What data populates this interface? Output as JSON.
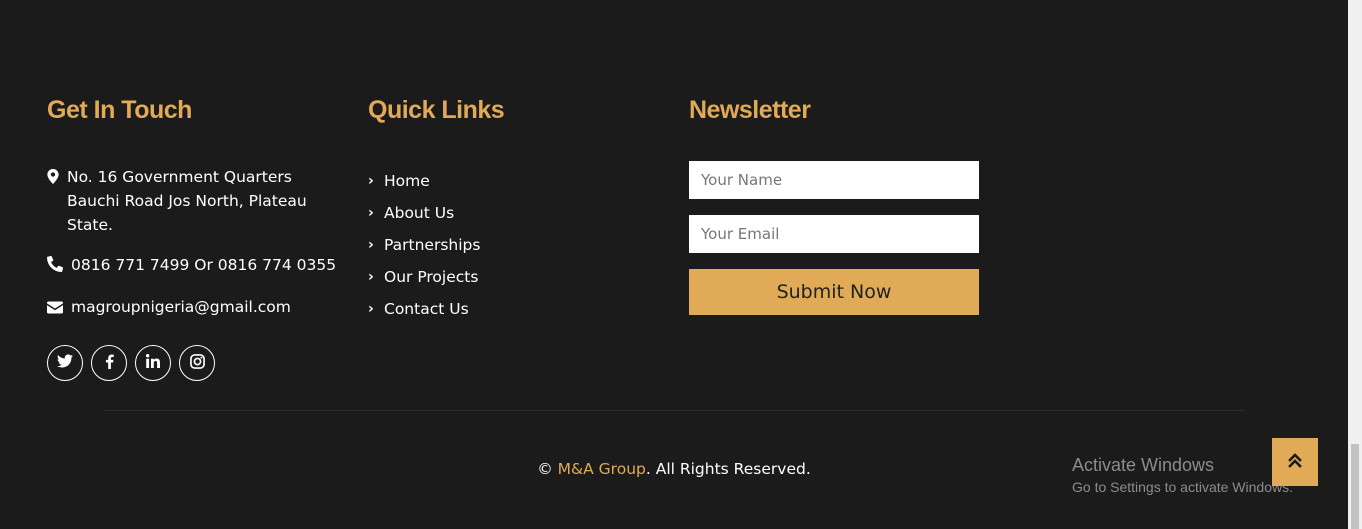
{
  "contact": {
    "title": "Get In Touch",
    "address": "No. 16 Government Quarters Bauchi Road Jos North, Plateau State.",
    "phone": "0816 771 7499 Or 0816 774 0355",
    "email": "magroupnigeria@gmail.com",
    "socials": [
      {
        "icon": "twitter-icon"
      },
      {
        "icon": "facebook-icon"
      },
      {
        "icon": "linkedin-icon"
      },
      {
        "icon": "instagram-icon"
      }
    ]
  },
  "quick_links": {
    "title": "Quick Links",
    "items": [
      "Home",
      "About Us",
      "Partnerships",
      "Our Projects",
      "Contact Us"
    ]
  },
  "newsletter": {
    "title": "Newsletter",
    "name_placeholder": "Your Name",
    "email_placeholder": "Your Email",
    "submit_label": "Submit Now"
  },
  "footer": {
    "copyright_symbol": "©",
    "brand": "M&A Group",
    "rights": ". All Rights Reserved."
  },
  "overlay": {
    "activate_title": "Activate Windows",
    "activate_subtitle": "Go to Settings to activate Windows."
  },
  "colors": {
    "background": "#1b1b1b",
    "accent": "#e0aa56",
    "text": "#ffffff"
  }
}
